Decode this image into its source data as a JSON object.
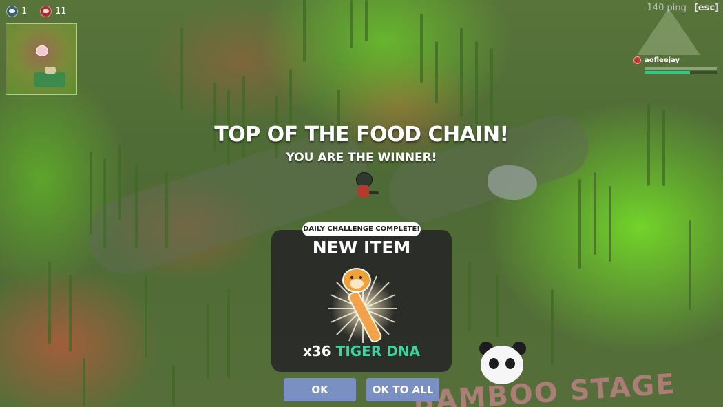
{
  "hud": {
    "kills_count": "1",
    "deaths_count": "11",
    "ping": "140 ping",
    "esc_label": "[esc]",
    "player_name": "aofleejay",
    "player_health": 0.62
  },
  "result": {
    "title": "TOP OF THE FOOD CHAIN!",
    "subtitle": "YOU ARE THE WINNER!"
  },
  "reward": {
    "badge": "DAILY CHALLENGE COMPLETE!",
    "heading": "NEW ITEM",
    "quantity": "x36",
    "item_name": "TIGER DNA",
    "item_icon": "tiger-dna-vial-icon"
  },
  "buttons": {
    "ok": "OK",
    "ok_to_all": "OK TO ALL"
  },
  "colors": {
    "item_name": "#3fd3a1",
    "button": "#7a8fc2",
    "card": "#282828",
    "health": "#34c784"
  }
}
